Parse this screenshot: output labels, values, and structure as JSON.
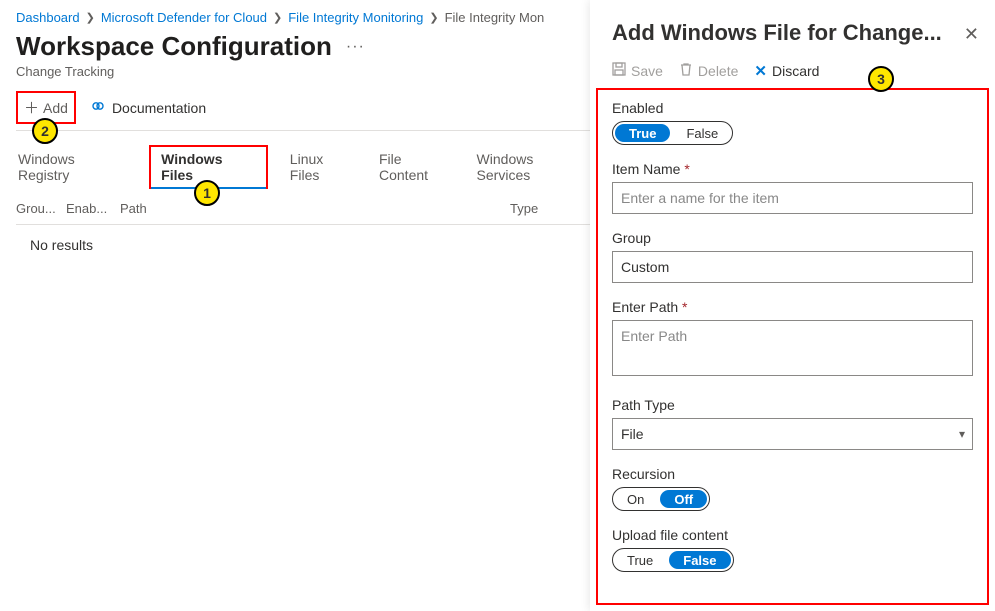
{
  "breadcrumb": {
    "items": [
      {
        "label": "Dashboard"
      },
      {
        "label": "Microsoft Defender for Cloud"
      },
      {
        "label": "File Integrity Monitoring"
      },
      {
        "label": "File Integrity Mon"
      }
    ]
  },
  "page": {
    "title": "Workspace Configuration",
    "subtitle": "Change Tracking"
  },
  "toolbar": {
    "add_label": "Add",
    "doc_label": "Documentation"
  },
  "tabs": [
    {
      "label": "Windows Registry"
    },
    {
      "label": "Windows Files"
    },
    {
      "label": "Linux Files"
    },
    {
      "label": "File Content"
    },
    {
      "label": "Windows Services"
    }
  ],
  "table": {
    "columns": {
      "group": "Grou...",
      "enabled": "Enab...",
      "path": "Path",
      "type": "Type"
    },
    "empty": "No results"
  },
  "panel": {
    "title": "Add Windows File for Change...",
    "actions": {
      "save": "Save",
      "delete": "Delete",
      "discard": "Discard"
    },
    "fields": {
      "enabled": {
        "label": "Enabled",
        "true": "True",
        "false": "False",
        "value": true
      },
      "item_name": {
        "label": "Item Name",
        "required": true,
        "placeholder": "Enter a name for the item",
        "value": ""
      },
      "group": {
        "label": "Group",
        "value": "Custom"
      },
      "enter_path": {
        "label": "Enter Path",
        "required": true,
        "placeholder": "Enter Path",
        "value": ""
      },
      "path_type": {
        "label": "Path Type",
        "value": "File"
      },
      "recursion": {
        "label": "Recursion",
        "on": "On",
        "off": "Off",
        "value": "Off"
      },
      "upload_content": {
        "label": "Upload file content",
        "true": "True",
        "false": "False",
        "value": false
      }
    }
  },
  "callouts": {
    "c1": "1",
    "c2": "2",
    "c3": "3"
  }
}
